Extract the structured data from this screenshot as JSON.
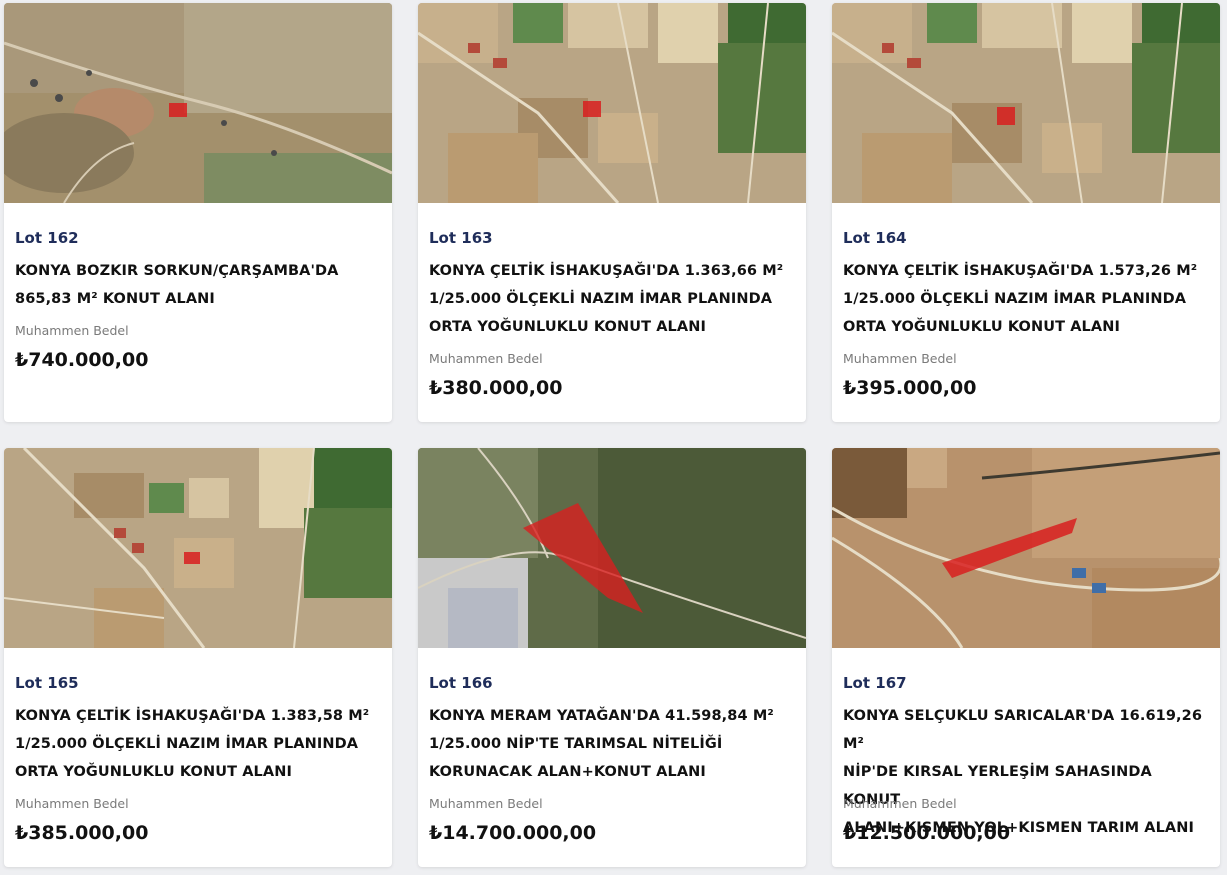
{
  "currency": "₺",
  "listings": [
    {
      "lot": "Lot 162",
      "title_lines": [
        "KONYA BOZKIR SORKUN/ÇARŞAMBA'DA",
        "865,83 M² KONUT ALANI"
      ],
      "price_label": "Muhammen Bedel",
      "price": "₺740.000,00",
      "image_alt": "satellite-map"
    },
    {
      "lot": "Lot 163",
      "title_lines": [
        "KONYA ÇELTİK İSHAKUŞAĞI'DA 1.363,66 M²",
        "1/25.000 ÖLÇEKLİ NAZIM İMAR PLANINDA",
        "ORTA YOĞUNLUKLU KONUT ALANI"
      ],
      "price_label": "Muhammen Bedel",
      "price": "₺380.000,00",
      "image_alt": "satellite-map"
    },
    {
      "lot": "Lot 164",
      "title_lines": [
        "KONYA ÇELTİK İSHAKUŞAĞI'DA 1.573,26 M²",
        "1/25.000 ÖLÇEKLİ NAZIM İMAR PLANINDA",
        "ORTA YOĞUNLUKLU KONUT ALANI"
      ],
      "price_label": "Muhammen Bedel",
      "price": "₺395.000,00",
      "image_alt": "satellite-map"
    },
    {
      "lot": "Lot 165",
      "title_lines": [
        "KONYA ÇELTİK İSHAKUŞAĞI'DA 1.383,58 M²",
        "1/25.000 ÖLÇEKLİ NAZIM İMAR PLANINDA",
        "ORTA YOĞUNLUKLU KONUT ALANI"
      ],
      "price_label": "Muhammen Bedel",
      "price": "₺385.000,00",
      "image_alt": "satellite-map"
    },
    {
      "lot": "Lot 166",
      "title_lines": [
        "KONYA MERAM YATAĞAN'DA 41.598,84 M²",
        "1/25.000 NİP'TE TARIMSAL NİTELİĞİ",
        "KORUNACAK ALAN+KONUT ALANI"
      ],
      "price_label": "Muhammen Bedel",
      "price": "₺14.700.000,00",
      "image_alt": "satellite-map"
    },
    {
      "lot": "Lot 167",
      "title_lines": [
        "KONYA SELÇUKLU SARICALAR'DA 16.619,26 M²",
        "NİP'DE KIRSAL YERLEŞİM SAHASINDA KONUT",
        "ALANI+KISMEN YOL+KISMEN TARIM ALANI"
      ],
      "price_label": "Muhammen Bedel",
      "price": "₺12.500.000,00",
      "image_alt": "satellite-map"
    }
  ],
  "colors": {
    "page_bg": "#eeeff2",
    "lot_color": "#1f2d5a",
    "title_color": "#111111",
    "label_color": "#7a7a7a",
    "parcel_red": "#d81f1f"
  }
}
